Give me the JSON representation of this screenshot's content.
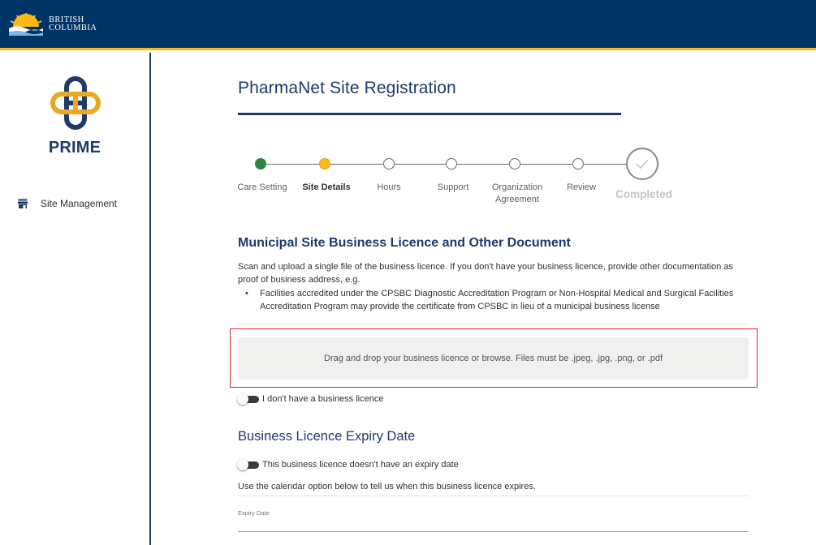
{
  "header": {
    "logo_line1": "BRITISH",
    "logo_line2": "COLUMBIA",
    "logo_icon": "bc-sun-icon"
  },
  "sidebar": {
    "app_name": "PRIME",
    "items": [
      {
        "label": "Site Management",
        "icon": "store-icon"
      }
    ]
  },
  "page": {
    "title": "PharmaNet Site Registration"
  },
  "stepper": {
    "steps": [
      {
        "label": "Care Setting",
        "state": "done"
      },
      {
        "label": "Site Details",
        "state": "current"
      },
      {
        "label": "Hours",
        "state": "todo"
      },
      {
        "label": "Support",
        "state": "todo"
      },
      {
        "label": "Organization Agreement",
        "state": "todo"
      },
      {
        "label": "Review",
        "state": "todo"
      }
    ],
    "completed_label": "Completed"
  },
  "licence_section": {
    "title": "Municipal Site Business Licence and Other Document",
    "description": "Scan and upload a single file of the business licence. If you don't have your business licence, provide other documentation as proof of business address, e.g.",
    "bullet": "Facilities accredited under the CPSBC Diagnostic Accreditation Program or Non-Hospital Medical and Surgical Facilities Accreditation Program may provide the certificate from CPSBC in lieu of a municipal business license",
    "dropzone_text": "Drag and drop your business licence or browse. Files must be .jpeg, .jpg, .png, or .pdf",
    "no_licence_toggle": "I don't have a business licence"
  },
  "expiry_section": {
    "title": "Business Licence Expiry Date",
    "no_expiry_toggle": "This business licence doesn't have an expiry date",
    "instruction": "Use the calendar option below to tell us when this business licence expires.",
    "field_label": "Expiry Date",
    "field_value": ""
  },
  "colors": {
    "header_bg": "#003366",
    "accent_gold": "#fcba19",
    "primary_navy": "#1e3a6b",
    "step_done": "#2e8540",
    "highlight_red": "#d8292f"
  }
}
